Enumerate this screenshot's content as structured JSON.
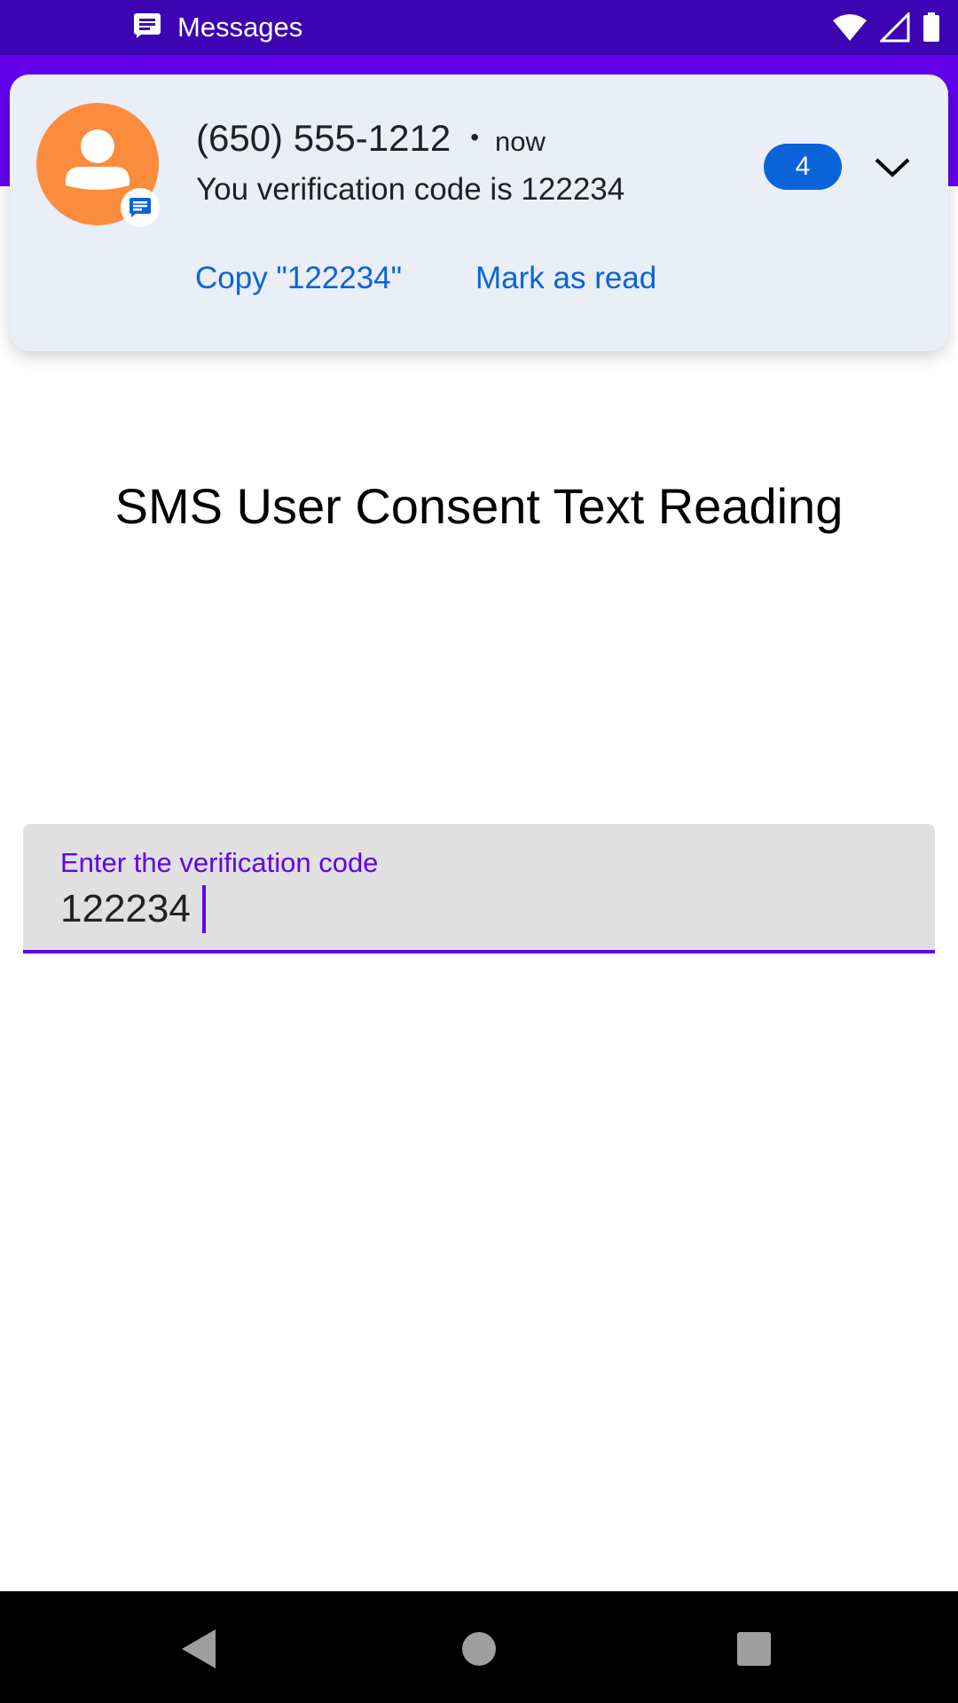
{
  "status_bar": {
    "app_label": "Messages",
    "icons": [
      "messages-icon",
      "wifi-icon",
      "cellular-icon",
      "battery-icon"
    ]
  },
  "notification": {
    "sender": "(650) 555-1212",
    "separator": "•",
    "time": "now",
    "body": "You verification code is 122234",
    "count": "4",
    "actions": {
      "copy": "Copy \"122234\"",
      "mark_read": "Mark as read"
    },
    "icons": [
      "avatar-person-icon",
      "messages-badge-icon",
      "chevron-down-icon"
    ]
  },
  "main": {
    "title": "SMS User Consent Text Reading",
    "field": {
      "label": "Enter the verification code",
      "value": "122234"
    }
  },
  "nav_bar": {
    "icons": [
      "back-icon",
      "home-icon",
      "recents-icon"
    ]
  },
  "colors": {
    "status_bar": "#3c04b3",
    "primary": "#6200ee",
    "notification_bg": "#e9eef7",
    "accent_blue": "#0b63d9",
    "avatar": "#fb8c3e"
  }
}
